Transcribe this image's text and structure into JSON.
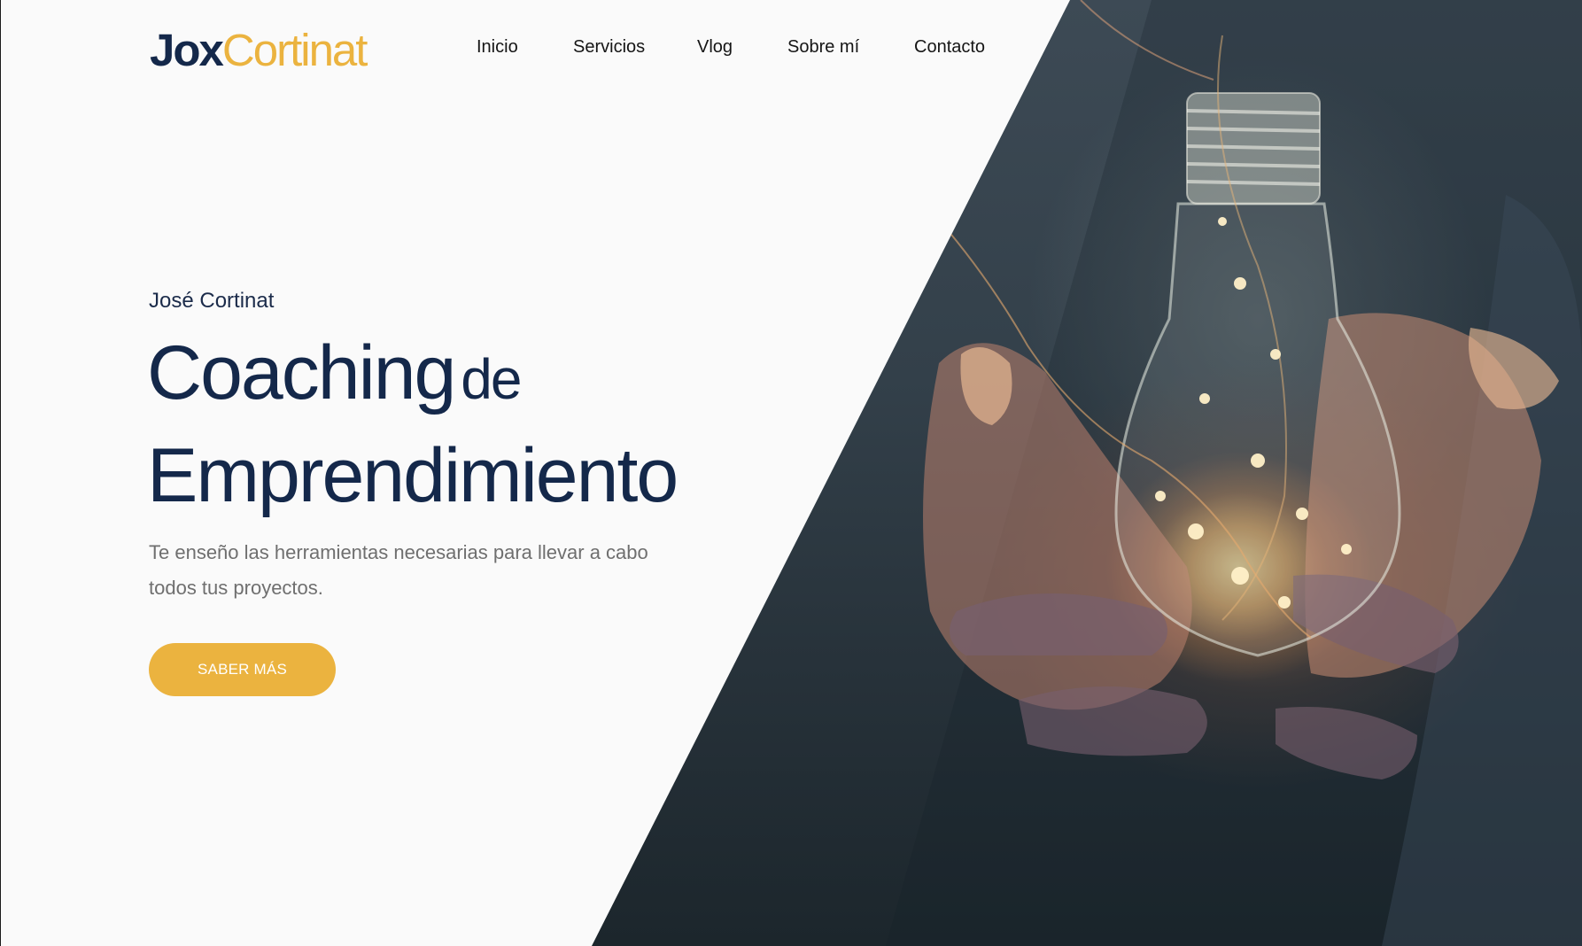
{
  "brand": {
    "logo_part1": "Jox",
    "logo_part2": "Cortinat",
    "primary_color": "#14284a",
    "accent_color": "#ebb33f"
  },
  "nav": {
    "items": [
      {
        "label": "Inicio"
      },
      {
        "label": "Servicios"
      },
      {
        "label": "Vlog"
      },
      {
        "label": "Sobre mí"
      },
      {
        "label": "Contacto"
      }
    ]
  },
  "hero": {
    "eyebrow": "José Cortinat",
    "headline_word1": "Coaching",
    "headline_word2": "de",
    "headline_line2": "Emprendimiento",
    "subtitle": "Te enseño las herramientas necesarias para llevar a cabo todos tus proyectos.",
    "cta_label": "SABER MÁS",
    "image_subject": "hands-holding-glowing-lightbulb"
  }
}
